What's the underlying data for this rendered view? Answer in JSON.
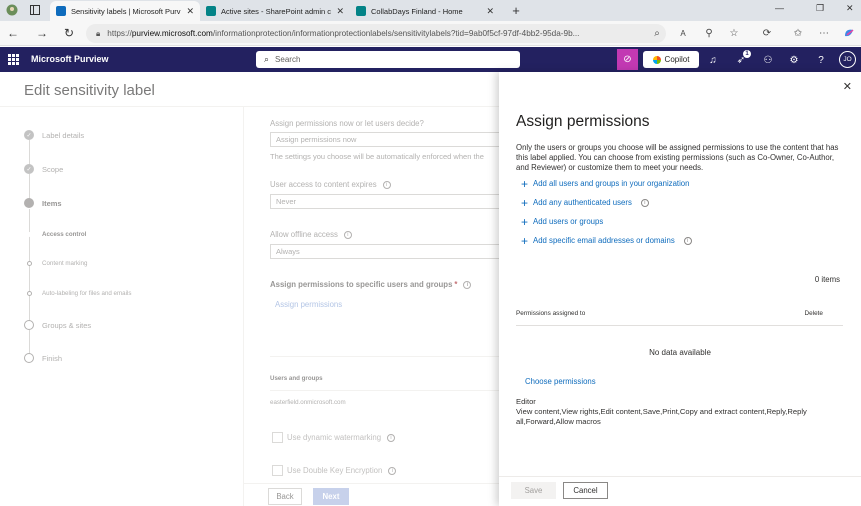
{
  "browser": {
    "tabs": [
      {
        "label": "Sensitivity labels | Microsoft Purv",
        "favicon_color": "#0f6cbd"
      },
      {
        "label": "Active sites - SharePoint admin c",
        "favicon_color": "#038387"
      },
      {
        "label": "CollabDays Finland - Home",
        "favicon_color": "#038387"
      }
    ],
    "new_tab": "+",
    "url_scheme": "https://",
    "url_domain": "purview.microsoft.com",
    "url_path": "/informationprotection/informationprotectionlabels/sensitivitylabels?tid=9ab0f5cf-97df-4bb2-95da-9b..."
  },
  "app_header": {
    "app_name": "Microsoft Purview",
    "search_placeholder": "Search",
    "copilot_label": "Copilot",
    "notification_count": "1",
    "avatar_initials": "JO"
  },
  "page": {
    "title": "Edit sensitivity label",
    "steps": [
      {
        "label": "Label details",
        "state": "done"
      },
      {
        "label": "Scope",
        "state": "done"
      },
      {
        "label": "Items",
        "state": "current"
      },
      {
        "label": "Access control",
        "state": "sub-current"
      },
      {
        "label": "Content marking",
        "state": "sub"
      },
      {
        "label": "Auto-labeling for files and emails",
        "state": "sub"
      },
      {
        "label": "Groups & sites",
        "state": "open"
      },
      {
        "label": "Finish",
        "state": "open"
      }
    ],
    "form": {
      "assign_question": "Assign permissions now or let users decide?",
      "assign_value": "Assign permissions now",
      "assign_help": "The settings you choose will be automatically enforced when the",
      "expires_label": "User access to content expires",
      "expires_value": "Never",
      "offline_label": "Allow offline access",
      "offline_value": "Always",
      "specific_label": "Assign permissions to specific users and groups",
      "required_mark": "*",
      "assign_link": "Assign permissions",
      "users_groups_header": "Users and groups",
      "users_groups_value": "easterfield.onmicrosoft.com",
      "dynamic_watermark": "Use dynamic watermarking",
      "double_key": "Use Double Key Encryption"
    },
    "back_label": "Back",
    "next_label": "Next"
  },
  "panel": {
    "title": "Assign permissions",
    "description": "Only the users or groups you choose will be assigned permissions to use the content that has this label applied. You can choose from existing permissions (such as Co-Owner, Co-Author, and Reviewer) or customize them to meet your needs.",
    "links": [
      {
        "label": "Add all users and groups in your organization",
        "info": false
      },
      {
        "label": "Add any authenticated users",
        "info": true
      },
      {
        "label": "Add users or groups",
        "info": false
      },
      {
        "label": "Add specific email addresses or domains",
        "info": true
      }
    ],
    "item_count": "0 items",
    "col_permissions": "Permissions assigned to",
    "col_delete": "Delete",
    "no_data": "No data available",
    "choose_permissions": "Choose permissions",
    "role_name": "Editor",
    "role_rights": "View content,View rights,Edit content,Save,Print,Copy and extract content,Reply,Reply all,Forward,Allow macros",
    "save_label": "Save",
    "cancel_label": "Cancel"
  }
}
